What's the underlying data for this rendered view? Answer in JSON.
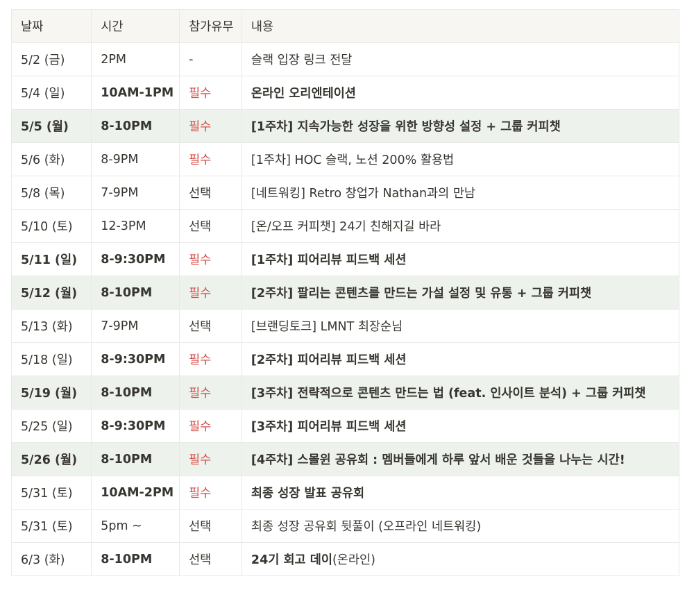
{
  "headers": {
    "date": "날짜",
    "time": "시간",
    "attendance": "참가유무",
    "content": "내용"
  },
  "rows": [
    {
      "date": "5/2 (금)",
      "time": "2PM",
      "attendance": "-",
      "content": "슬랙 입장 링크 전달",
      "content_suffix": ""
    },
    {
      "date": "5/4 (일)",
      "time": "10AM-1PM",
      "attendance": "필수",
      "content": "온라인 오리엔테이션",
      "content_suffix": ""
    },
    {
      "date": "5/5 (월)",
      "time": "8-10PM",
      "attendance": "필수",
      "content": "[1주차] 지속가능한 성장을 위한 방향성 설정 + 그룹 커피챗",
      "content_suffix": ""
    },
    {
      "date": "5/6 (화)",
      "time": "8-9PM",
      "attendance": "필수",
      "content": "[1주차] HOC 슬랙, 노션 200% 활용법",
      "content_suffix": ""
    },
    {
      "date": "5/8 (목)",
      "time": "7-9PM",
      "attendance": "선택",
      "content": "[네트워킹] Retro 창업가 Nathan과의 만남",
      "content_suffix": ""
    },
    {
      "date": "5/10 (토)",
      "time": "12-3PM",
      "attendance": "선택",
      "content": "[온/오프 커피챗] 24기 친해지길 바라",
      "content_suffix": ""
    },
    {
      "date": "5/11 (일)",
      "time": "8-9:30PM",
      "attendance": "필수",
      "content": "[1주차] 피어리뷰 피드백 세션",
      "content_suffix": ""
    },
    {
      "date": "5/12 (월)",
      "time": "8-10PM",
      "attendance": "필수",
      "content": "[2주차] 팔리는 콘텐츠를 만드는 가설 설정 및 유통 + 그룹 커피챗",
      "content_suffix": ""
    },
    {
      "date": "5/13 (화)",
      "time": "7-9PM",
      "attendance": "선택",
      "content": "[브랜딩토크] LMNT 최장순님",
      "content_suffix": ""
    },
    {
      "date": "5/18 (일)",
      "time": "8-9:30PM",
      "attendance": "필수",
      "content": "[2주차] 피어리뷰 피드백 세션",
      "content_suffix": ""
    },
    {
      "date": "5/19 (월)",
      "time": "8-10PM",
      "attendance": "필수",
      "content": "[3주차] 전략적으로 콘텐츠 만드는 법 (feat. 인사이트 분석) + 그룹 커피챗",
      "content_suffix": ""
    },
    {
      "date": "5/25 (일)",
      "time": "8-9:30PM",
      "attendance": "필수",
      "content": "[3주차] 피어리뷰 피드백 세션",
      "content_suffix": ""
    },
    {
      "date": "5/26 (월)",
      "time": "8-10PM",
      "attendance": "필수",
      "content": "[4주차] 스몰윈 공유회 : 멤버들에게 하루 앞서 배운 것들을 나누는 시간!",
      "content_suffix": ""
    },
    {
      "date": "5/31 (토)",
      "time": "10AM-2PM",
      "attendance": "필수",
      "content": "최종 성장 발표 공유회",
      "content_suffix": ""
    },
    {
      "date": "5/31 (토)",
      "time": "5pm ~",
      "attendance": "선택",
      "content": "최종 성장 공유회 뒷풀이 (오프라인 네트워킹)",
      "content_suffix": ""
    },
    {
      "date": "6/3 (화)",
      "time": "8-10PM",
      "attendance": "선택",
      "content": "24기 회고 데이",
      "content_suffix": "(온라인)"
    }
  ],
  "colors": {
    "required": "#d44c47",
    "highlight_row": "#edf3ec",
    "header_bg": "#f7f6f3",
    "border": "#e9e9e7",
    "text": "#37352f"
  }
}
